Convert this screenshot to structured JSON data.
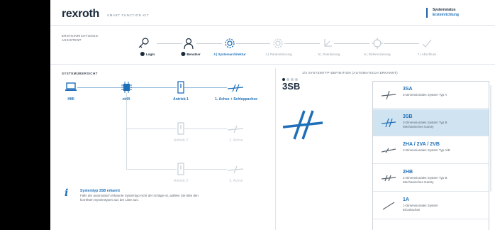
{
  "header": {
    "logo": "rexroth",
    "kit": "SMART FUNCTION KIT",
    "status_title": "Systemstatus",
    "status_value": "Ersteinrichtung"
  },
  "assistant": {
    "title": "ERSTEINRICHTUNGS-ASSISTENT",
    "steps": [
      {
        "label": "Login",
        "state": "done",
        "icon": "key-icon"
      },
      {
        "label": "Benutzer",
        "state": "done",
        "icon": "user-icon"
      },
      {
        "label": "3 | Systemarchitektur",
        "state": "active",
        "icon": "gear-icon"
      },
      {
        "label": "4 | Parametrierung",
        "state": "todo",
        "icon": "settings-icon"
      },
      {
        "label": "5 | Orientierung",
        "state": "todo",
        "icon": "orientation-icon"
      },
      {
        "label": "6 | Referenzierung",
        "state": "todo",
        "icon": "target-icon"
      },
      {
        "label": "7 | Abschluss",
        "state": "todo",
        "icon": "check-icon"
      }
    ]
  },
  "overview": {
    "title": "SYSTEMÜBERSICHT",
    "nodes": {
      "hmi": "HMI",
      "ctrlx": "ctrlX",
      "antrieb1": "Antrieb 1",
      "achse1": "1. Achse + Schleppachse",
      "antrieb2": "Antrieb 2",
      "achse2": "2. Achse",
      "antrieb3": "Antrieb 3",
      "achse3": "3. Achse"
    }
  },
  "info": {
    "title": "Systemtyp 3SB erkannt",
    "body": "Falls der automatisch erkannte Systemtyp nicht der richtige ist, wählen Sie bitte den korrekten Systemtypen aus der Liste aus."
  },
  "definition": {
    "title": "1/4 SYSTEMTYP-DEFINITION (AUTOMATISCH ERKANNT)",
    "current_code": "3SB",
    "page": 1,
    "pages": 4,
    "types": [
      {
        "code": "3SA",
        "line1": "3-Dimensionales System Typ A",
        "line2": "",
        "selected": false
      },
      {
        "code": "3SB",
        "line1": "3-Dimensionales System Typ B",
        "line2": "Mechanisches Gantry",
        "selected": true
      },
      {
        "code": "2HA / 2VA / 2VB",
        "line1": "2-Dimensionales System Typ A/B",
        "line2": "",
        "selected": false
      },
      {
        "code": "2HB",
        "line1": "2-Dimensionales System Typ B",
        "line2": "Mechanisches Gantry",
        "selected": false
      },
      {
        "code": "1A",
        "line1": "1-Dimensionales System",
        "line2": "Einzelachse",
        "selected": false
      }
    ]
  },
  "colors": {
    "accent": "#1e6fb8",
    "selected_bg": "#cfe3f1",
    "text_dark": "#1b2a3a"
  }
}
